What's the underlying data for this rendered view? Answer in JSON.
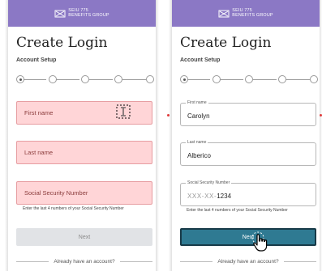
{
  "brand": {
    "line1": "SEIU 775",
    "line2": "BENEFITS GROUP",
    "header_color": "#8b78c5"
  },
  "left": {
    "title": "Create Login",
    "subtitle": "Account Setup",
    "fields": {
      "first_name": "First name",
      "last_name": "Last name",
      "ssn": "Social Security Number"
    },
    "helper": "Enter the last 4 numbers of your Social Security Number",
    "next": "Next",
    "footer": "Already have an account?"
  },
  "right": {
    "title": "Create Login",
    "subtitle": "Account Setup",
    "fields": {
      "first_name": {
        "label": "First name",
        "value": "Carolyn"
      },
      "last_name": {
        "label": "Last name",
        "value": "Alberico"
      },
      "ssn": {
        "label": "Social Security Number",
        "mask": "XXX-XX-",
        "value": "1234"
      }
    },
    "helper": "Enter the last 4 numbers of your Social Security Number",
    "next": "Next",
    "footer": "Already have an account?"
  },
  "stepper": {
    "steps": 5,
    "current": 1
  },
  "colors": {
    "error_fill": "#ffd5d7",
    "error_border": "#e79da1",
    "primary": "#2f7a92"
  }
}
